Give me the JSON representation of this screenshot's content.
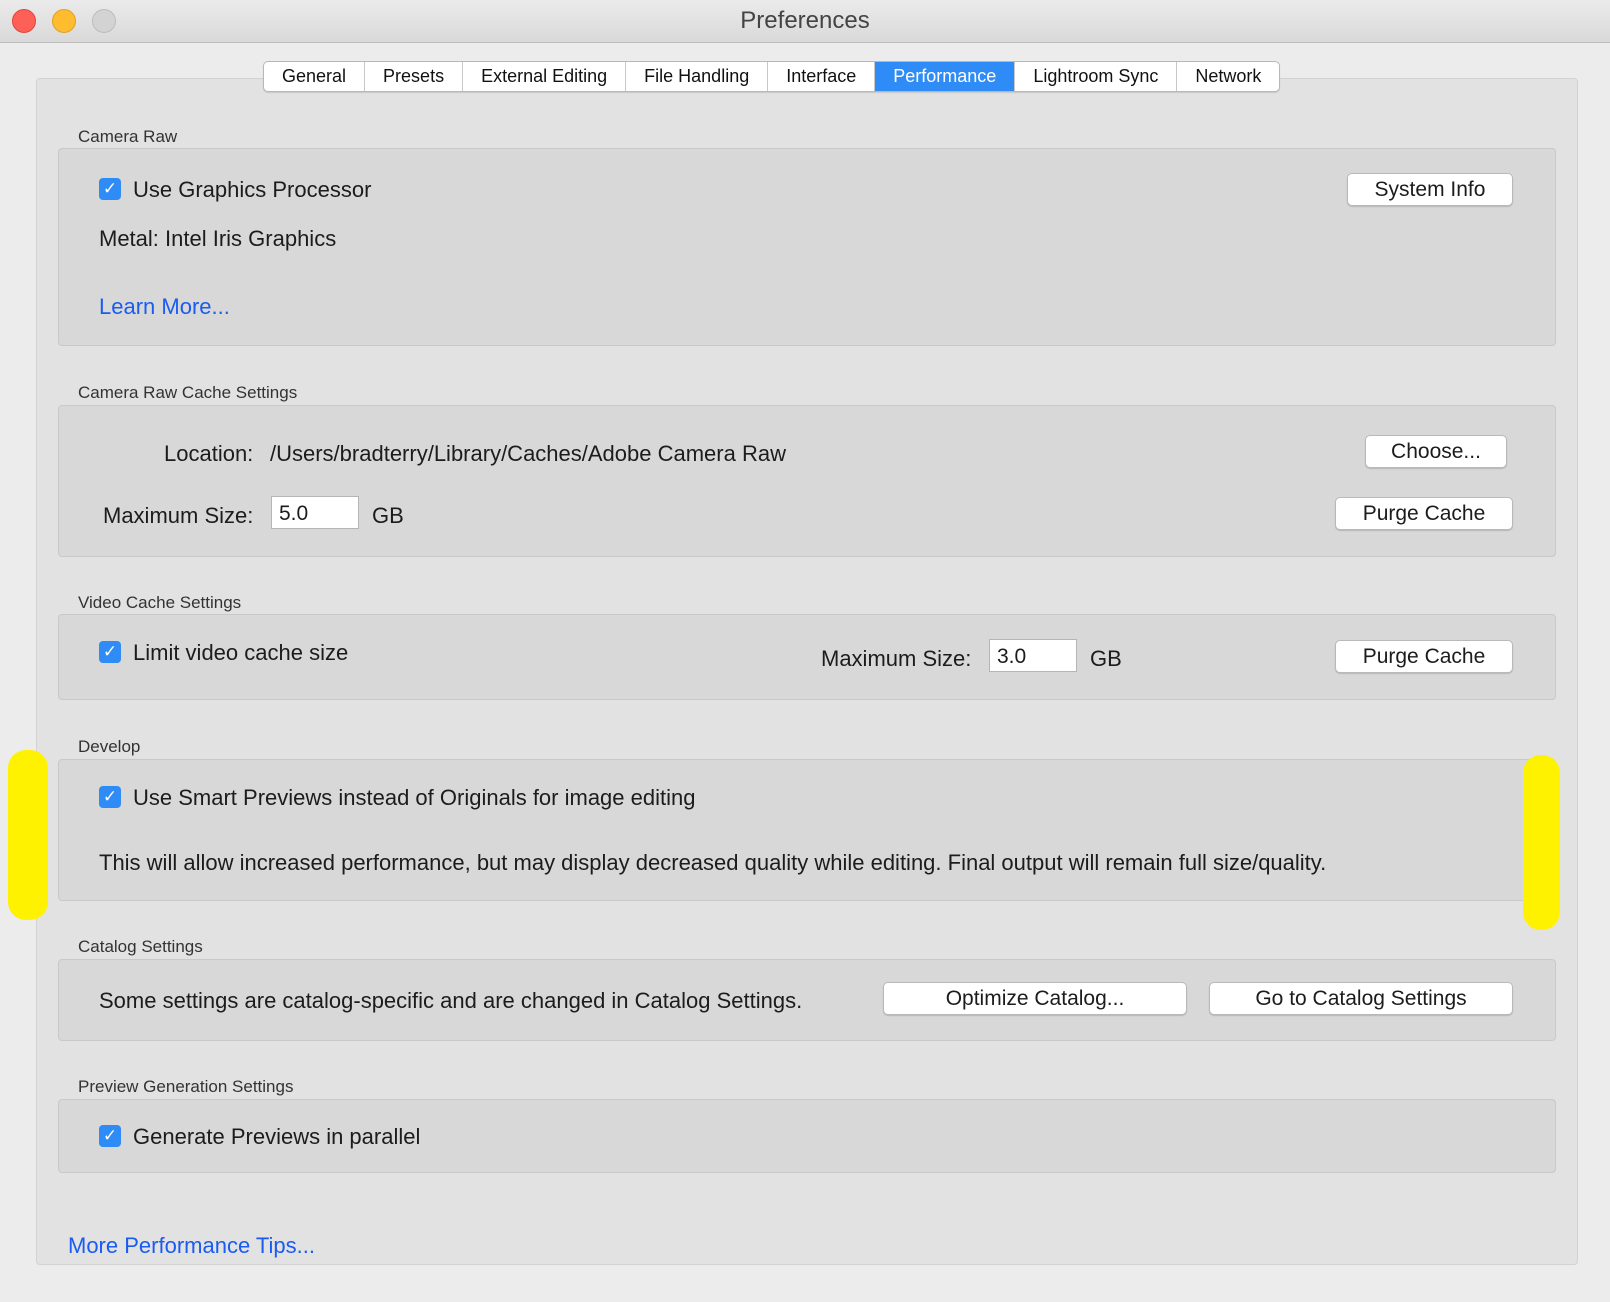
{
  "window": {
    "title": "Preferences"
  },
  "tabs": [
    {
      "label": "General"
    },
    {
      "label": "Presets"
    },
    {
      "label": "External Editing"
    },
    {
      "label": "File Handling"
    },
    {
      "label": "Interface"
    },
    {
      "label": "Performance",
      "active": true
    },
    {
      "label": "Lightroom Sync"
    },
    {
      "label": "Network"
    }
  ],
  "camera_raw": {
    "heading": "Camera Raw",
    "use_gpu_label": "Use Graphics Processor",
    "use_gpu_checked": true,
    "gpu_info": "Metal: Intel Iris Graphics",
    "learn_more": "Learn More...",
    "system_info_button": "System Info"
  },
  "cache": {
    "heading": "Camera Raw Cache Settings",
    "location_label": "Location:",
    "location_value": "/Users/bradterry/Library/Caches/Adobe Camera Raw",
    "choose_button": "Choose...",
    "max_size_label": "Maximum Size:",
    "max_size_value": "5.0",
    "unit": "GB",
    "purge_button": "Purge Cache"
  },
  "video_cache": {
    "heading": "Video Cache Settings",
    "limit_label": "Limit video cache size",
    "limit_checked": true,
    "max_size_label": "Maximum Size:",
    "max_size_value": "3.0",
    "unit": "GB",
    "purge_button": "Purge Cache"
  },
  "develop": {
    "heading": "Develop",
    "smart_previews_label": "Use Smart Previews instead of Originals for image editing",
    "smart_previews_checked": true,
    "description": "This will allow increased performance, but may display decreased quality while editing. Final output will remain full size/quality."
  },
  "catalog": {
    "heading": "Catalog Settings",
    "description": "Some settings are catalog-specific and are changed in Catalog Settings.",
    "optimize_button": "Optimize Catalog...",
    "goto_button": "Go to Catalog Settings"
  },
  "preview_gen": {
    "heading": "Preview Generation Settings",
    "parallel_label": "Generate Previews in parallel",
    "parallel_checked": true
  },
  "footer": {
    "tips_link": "More Performance Tips..."
  },
  "colors": {
    "accent": "#2f8cf6",
    "link": "#1a5cf0",
    "highlight": "#fff200"
  }
}
